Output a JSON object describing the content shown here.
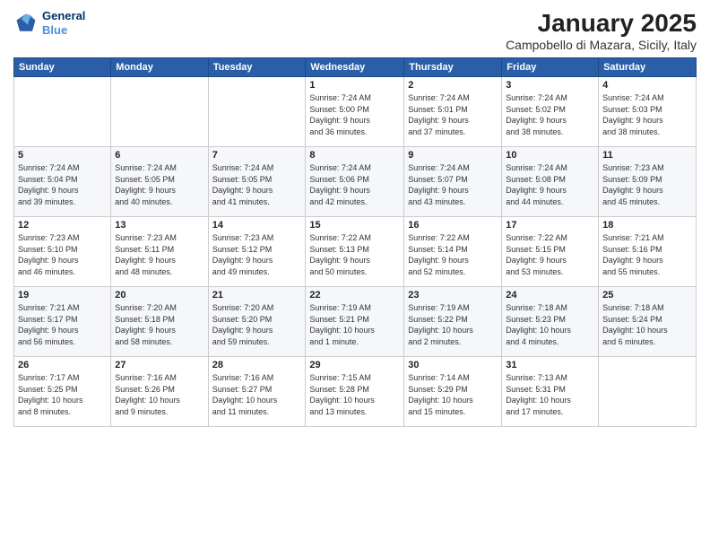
{
  "header": {
    "logo_line1": "General",
    "logo_line2": "Blue",
    "month": "January 2025",
    "location": "Campobello di Mazara, Sicily, Italy"
  },
  "weekdays": [
    "Sunday",
    "Monday",
    "Tuesday",
    "Wednesday",
    "Thursday",
    "Friday",
    "Saturday"
  ],
  "weeks": [
    [
      {
        "day": "",
        "info": ""
      },
      {
        "day": "",
        "info": ""
      },
      {
        "day": "",
        "info": ""
      },
      {
        "day": "1",
        "info": "Sunrise: 7:24 AM\nSunset: 5:00 PM\nDaylight: 9 hours\nand 36 minutes."
      },
      {
        "day": "2",
        "info": "Sunrise: 7:24 AM\nSunset: 5:01 PM\nDaylight: 9 hours\nand 37 minutes."
      },
      {
        "day": "3",
        "info": "Sunrise: 7:24 AM\nSunset: 5:02 PM\nDaylight: 9 hours\nand 38 minutes."
      },
      {
        "day": "4",
        "info": "Sunrise: 7:24 AM\nSunset: 5:03 PM\nDaylight: 9 hours\nand 38 minutes."
      }
    ],
    [
      {
        "day": "5",
        "info": "Sunrise: 7:24 AM\nSunset: 5:04 PM\nDaylight: 9 hours\nand 39 minutes."
      },
      {
        "day": "6",
        "info": "Sunrise: 7:24 AM\nSunset: 5:05 PM\nDaylight: 9 hours\nand 40 minutes."
      },
      {
        "day": "7",
        "info": "Sunrise: 7:24 AM\nSunset: 5:05 PM\nDaylight: 9 hours\nand 41 minutes."
      },
      {
        "day": "8",
        "info": "Sunrise: 7:24 AM\nSunset: 5:06 PM\nDaylight: 9 hours\nand 42 minutes."
      },
      {
        "day": "9",
        "info": "Sunrise: 7:24 AM\nSunset: 5:07 PM\nDaylight: 9 hours\nand 43 minutes."
      },
      {
        "day": "10",
        "info": "Sunrise: 7:24 AM\nSunset: 5:08 PM\nDaylight: 9 hours\nand 44 minutes."
      },
      {
        "day": "11",
        "info": "Sunrise: 7:23 AM\nSunset: 5:09 PM\nDaylight: 9 hours\nand 45 minutes."
      }
    ],
    [
      {
        "day": "12",
        "info": "Sunrise: 7:23 AM\nSunset: 5:10 PM\nDaylight: 9 hours\nand 46 minutes."
      },
      {
        "day": "13",
        "info": "Sunrise: 7:23 AM\nSunset: 5:11 PM\nDaylight: 9 hours\nand 48 minutes."
      },
      {
        "day": "14",
        "info": "Sunrise: 7:23 AM\nSunset: 5:12 PM\nDaylight: 9 hours\nand 49 minutes."
      },
      {
        "day": "15",
        "info": "Sunrise: 7:22 AM\nSunset: 5:13 PM\nDaylight: 9 hours\nand 50 minutes."
      },
      {
        "day": "16",
        "info": "Sunrise: 7:22 AM\nSunset: 5:14 PM\nDaylight: 9 hours\nand 52 minutes."
      },
      {
        "day": "17",
        "info": "Sunrise: 7:22 AM\nSunset: 5:15 PM\nDaylight: 9 hours\nand 53 minutes."
      },
      {
        "day": "18",
        "info": "Sunrise: 7:21 AM\nSunset: 5:16 PM\nDaylight: 9 hours\nand 55 minutes."
      }
    ],
    [
      {
        "day": "19",
        "info": "Sunrise: 7:21 AM\nSunset: 5:17 PM\nDaylight: 9 hours\nand 56 minutes."
      },
      {
        "day": "20",
        "info": "Sunrise: 7:20 AM\nSunset: 5:18 PM\nDaylight: 9 hours\nand 58 minutes."
      },
      {
        "day": "21",
        "info": "Sunrise: 7:20 AM\nSunset: 5:20 PM\nDaylight: 9 hours\nand 59 minutes."
      },
      {
        "day": "22",
        "info": "Sunrise: 7:19 AM\nSunset: 5:21 PM\nDaylight: 10 hours\nand 1 minute."
      },
      {
        "day": "23",
        "info": "Sunrise: 7:19 AM\nSunset: 5:22 PM\nDaylight: 10 hours\nand 2 minutes."
      },
      {
        "day": "24",
        "info": "Sunrise: 7:18 AM\nSunset: 5:23 PM\nDaylight: 10 hours\nand 4 minutes."
      },
      {
        "day": "25",
        "info": "Sunrise: 7:18 AM\nSunset: 5:24 PM\nDaylight: 10 hours\nand 6 minutes."
      }
    ],
    [
      {
        "day": "26",
        "info": "Sunrise: 7:17 AM\nSunset: 5:25 PM\nDaylight: 10 hours\nand 8 minutes."
      },
      {
        "day": "27",
        "info": "Sunrise: 7:16 AM\nSunset: 5:26 PM\nDaylight: 10 hours\nand 9 minutes."
      },
      {
        "day": "28",
        "info": "Sunrise: 7:16 AM\nSunset: 5:27 PM\nDaylight: 10 hours\nand 11 minutes."
      },
      {
        "day": "29",
        "info": "Sunrise: 7:15 AM\nSunset: 5:28 PM\nDaylight: 10 hours\nand 13 minutes."
      },
      {
        "day": "30",
        "info": "Sunrise: 7:14 AM\nSunset: 5:29 PM\nDaylight: 10 hours\nand 15 minutes."
      },
      {
        "day": "31",
        "info": "Sunrise: 7:13 AM\nSunset: 5:31 PM\nDaylight: 10 hours\nand 17 minutes."
      },
      {
        "day": "",
        "info": ""
      }
    ]
  ]
}
